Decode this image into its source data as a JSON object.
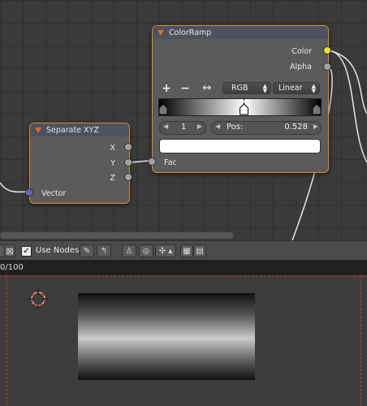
{
  "node_editor": {
    "color_ramp": {
      "title": "ColorRamp",
      "outputs": [
        "Color",
        "Alpha"
      ],
      "input_fac": "Fac",
      "add_label": "+",
      "remove_label": "−",
      "flip_label": "↔",
      "color_mode": "RGB",
      "interpolation": "Linear",
      "stop_index": "1",
      "pos_label": "Pos:",
      "pos_value": "0.528",
      "stop_position": 0.528
    },
    "separate_xyz": {
      "title": "Separate XYZ",
      "outputs": [
        "X",
        "Y",
        "Z"
      ],
      "input_vector": "Vector"
    }
  },
  "toolbar": {
    "use_nodes_label": "Use Nodes",
    "use_nodes_checked": true
  },
  "status": {
    "progress_text": "0/100"
  },
  "colors": {
    "node_border": "#d88a2f",
    "header": "#4e5160",
    "color_socket": "#e4e42a",
    "vector_socket": "#6363c7",
    "render_border": "#c83a3a"
  }
}
